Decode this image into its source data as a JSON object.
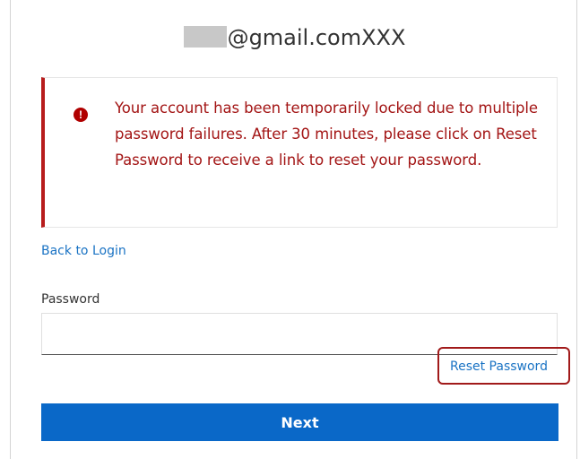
{
  "identifier": {
    "email_suffix": "@gmail.comXXX"
  },
  "alert": {
    "icon": "alert-circle-icon",
    "icon_glyph": "!",
    "message": "Your account has been temporarily locked due to multiple password failures. After 30 minutes, please click on Reset Password to receive a link to reset your password.",
    "color": "#a31515",
    "accent_color": "#b71c1c"
  },
  "links": {
    "back_to_login": "Back to Login",
    "reset_password": "Reset Password"
  },
  "password": {
    "label": "Password",
    "value": "",
    "placeholder": ""
  },
  "buttons": {
    "next": "Next",
    "next_color": "#0a68c8"
  }
}
